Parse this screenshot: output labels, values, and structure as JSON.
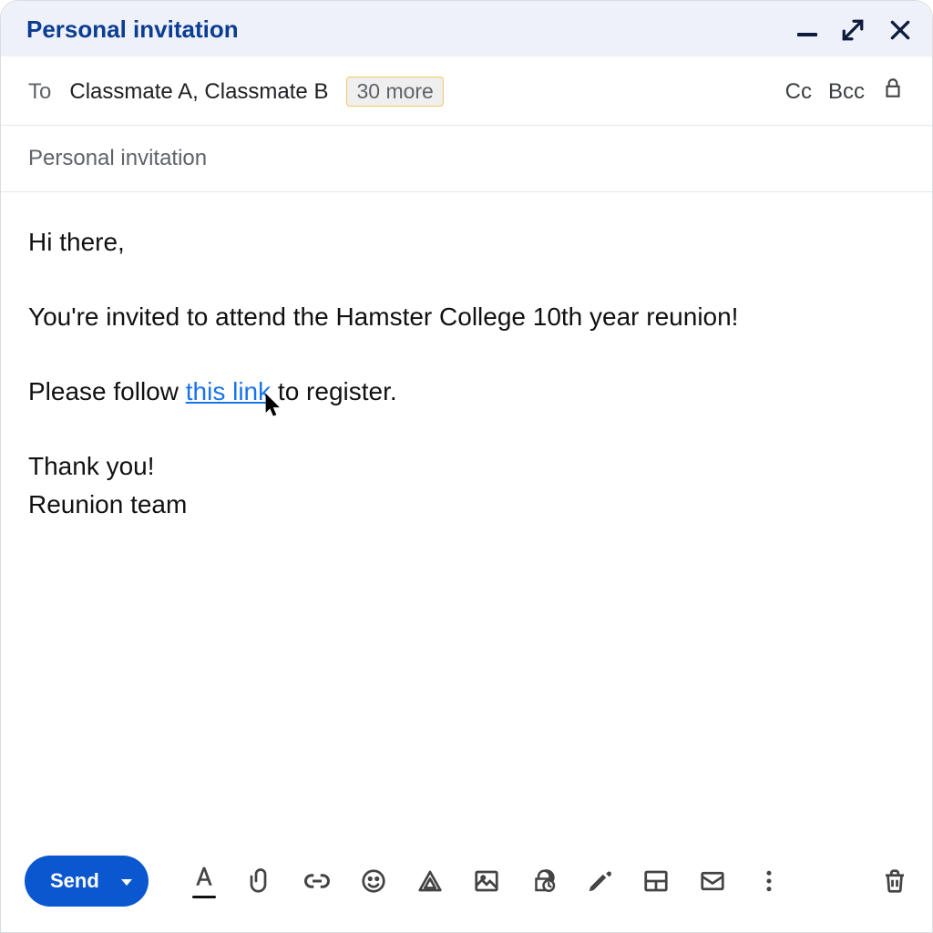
{
  "window": {
    "title": "Personal invitation"
  },
  "to": {
    "label": "To",
    "recipients": "Classmate A, Classmate B",
    "more_chip": "30 more",
    "cc_label": "Cc",
    "bcc_label": "Bcc"
  },
  "subject": {
    "text": "Personal invitation"
  },
  "body": {
    "greeting": "Hi there,",
    "line1": "You're invited to attend the Hamster College 10th year reunion!",
    "line2_pre": "Please follow ",
    "line2_link": "this link",
    "line2_post": " to register.",
    "thanks": "Thank you!",
    "signature": "Reunion team"
  },
  "toolbar": {
    "send_label": "Send"
  },
  "icons": {
    "minimize": "minimize-icon",
    "expand": "expand-icon",
    "close": "close-icon",
    "lock": "lock-icon",
    "format": "text-format-icon",
    "attach": "paperclip-icon",
    "link": "link-icon",
    "emoji": "smiley-icon",
    "drive": "drive-triangle-icon",
    "image": "image-icon",
    "confidential": "clock-lock-icon",
    "pen": "pen-icon",
    "layout": "layout-icon",
    "envelope": "envelope-icon",
    "more": "more-vert-icon",
    "trash": "trash-icon"
  },
  "colors": {
    "accent": "#0b57d0",
    "title": "#0b3d91",
    "link": "#1a73e8"
  }
}
